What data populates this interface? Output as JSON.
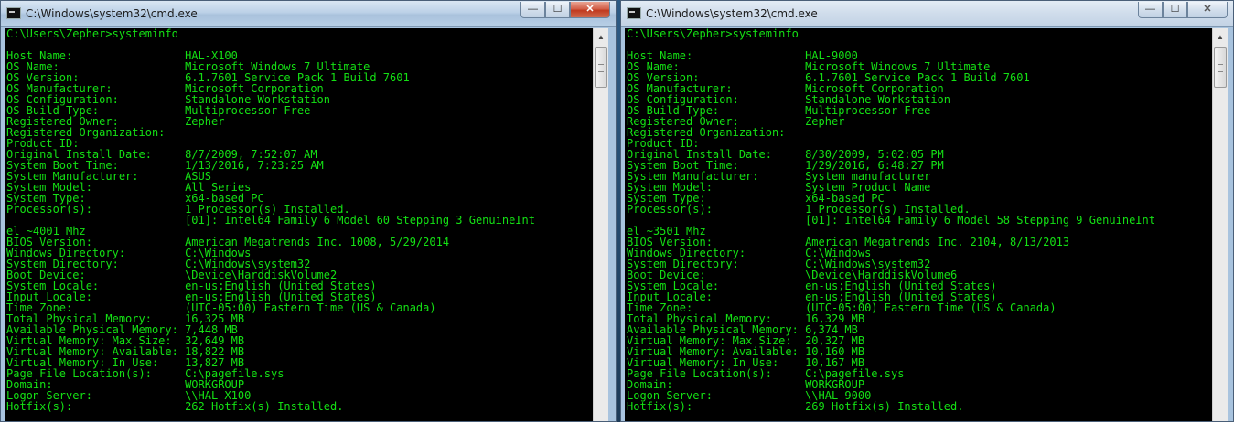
{
  "windows": [
    {
      "title": "C:\\Windows\\system32\\cmd.exe",
      "prompt": "C:\\Users\\Zepher>systeminfo",
      "lines": [
        "",
        "Host Name:                 HAL-X100",
        "OS Name:                   Microsoft Windows 7 Ultimate",
        "OS Version:                6.1.7601 Service Pack 1 Build 7601",
        "OS Manufacturer:           Microsoft Corporation",
        "OS Configuration:          Standalone Workstation",
        "OS Build Type:             Multiprocessor Free",
        "Registered Owner:          Zepher",
        "Registered Organization:",
        "Product ID:",
        "Original Install Date:     8/7/2009, 7:52:07 AM",
        "System Boot Time:          1/13/2016, 7:23:25 AM",
        "System Manufacturer:       ASUS",
        "System Model:              All Series",
        "System Type:               x64-based PC",
        "Processor(s):              1 Processor(s) Installed.",
        "                           [01]: Intel64 Family 6 Model 60 Stepping 3 GenuineInt",
        "el ~4001 Mhz",
        "BIOS Version:              American Megatrends Inc. 1008, 5/29/2014",
        "Windows Directory:         C:\\Windows",
        "System Directory:          C:\\Windows\\system32",
        "Boot Device:               \\Device\\HarddiskVolume2",
        "System Locale:             en-us;English (United States)",
        "Input Locale:              en-us;English (United States)",
        "Time Zone:                 (UTC-05:00) Eastern Time (US & Canada)",
        "Total Physical Memory:     16,325 MB",
        "Available Physical Memory: 7,448 MB",
        "Virtual Memory: Max Size:  32,649 MB",
        "Virtual Memory: Available: 18,822 MB",
        "Virtual Memory: In Use:    13,827 MB",
        "Page File Location(s):     C:\\pagefile.sys",
        "Domain:                    WORKGROUP",
        "Logon Server:              \\\\HAL-X100",
        "Hotfix(s):                 262 Hotfix(s) Installed."
      ]
    },
    {
      "title": "C:\\Windows\\system32\\cmd.exe",
      "prompt": "C:\\Users\\Zepher>systeminfo",
      "lines": [
        "",
        "Host Name:                 HAL-9000",
        "OS Name:                   Microsoft Windows 7 Ultimate",
        "OS Version:                6.1.7601 Service Pack 1 Build 7601",
        "OS Manufacturer:           Microsoft Corporation",
        "OS Configuration:          Standalone Workstation",
        "OS Build Type:             Multiprocessor Free",
        "Registered Owner:          Zepher",
        "Registered Organization:",
        "Product ID:",
        "Original Install Date:     8/30/2009, 5:02:05 PM",
        "System Boot Time:          1/29/2016, 6:48:27 PM",
        "System Manufacturer:       System manufacturer",
        "System Model:              System Product Name",
        "System Type:               x64-based PC",
        "Processor(s):              1 Processor(s) Installed.",
        "                           [01]: Intel64 Family 6 Model 58 Stepping 9 GenuineInt",
        "el ~3501 Mhz",
        "BIOS Version:              American Megatrends Inc. 2104, 8/13/2013",
        "Windows Directory:         C:\\Windows",
        "System Directory:          C:\\Windows\\system32",
        "Boot Device:               \\Device\\HarddiskVolume6",
        "System Locale:             en-us;English (United States)",
        "Input Locale:              en-us;English (United States)",
        "Time Zone:                 (UTC-05:00) Eastern Time (US & Canada)",
        "Total Physical Memory:     16,329 MB",
        "Available Physical Memory: 6,374 MB",
        "Virtual Memory: Max Size:  20,327 MB",
        "Virtual Memory: Available: 10,160 MB",
        "Virtual Memory: In Use:    10,167 MB",
        "Page File Location(s):     C:\\pagefile.sys",
        "Domain:                    WORKGROUP",
        "Logon Server:              \\\\HAL-9000",
        "Hotfix(s):                 269 Hotfix(s) Installed."
      ]
    }
  ],
  "caption_buttons": {
    "minimize": "—",
    "maximize": "☐",
    "close": "✕"
  },
  "scrollbar": {
    "up_arrow": "▲"
  },
  "colors": {
    "console_text": "#14e014",
    "console_bg": "#000000",
    "close_button": "#c0391f"
  }
}
